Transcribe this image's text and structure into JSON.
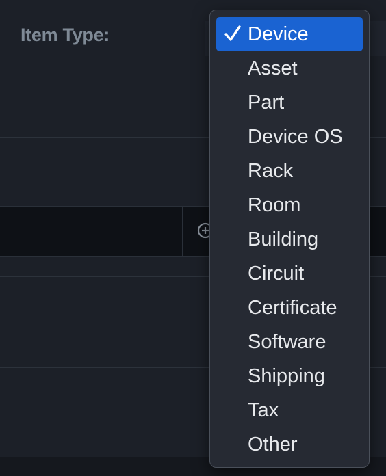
{
  "form": {
    "item_type_label": "Item Type:"
  },
  "dropdown": {
    "selected": "Device",
    "options": [
      {
        "label": "Device",
        "selected": true
      },
      {
        "label": "Asset",
        "selected": false
      },
      {
        "label": "Part",
        "selected": false
      },
      {
        "label": "Device OS",
        "selected": false
      },
      {
        "label": "Rack",
        "selected": false
      },
      {
        "label": "Room",
        "selected": false
      },
      {
        "label": "Building",
        "selected": false
      },
      {
        "label": "Circuit",
        "selected": false
      },
      {
        "label": "Certificate",
        "selected": false
      },
      {
        "label": "Software",
        "selected": false
      },
      {
        "label": "Shipping",
        "selected": false
      },
      {
        "label": "Tax",
        "selected": false
      },
      {
        "label": "Other",
        "selected": false
      }
    ],
    "check_icon": "checkmark-icon"
  },
  "colors": {
    "background": "#1c2028",
    "menu_background": "#262a33",
    "selected_highlight": "#1a63d2",
    "label_text": "#7f8a96",
    "menu_text": "#e7e9ec"
  }
}
